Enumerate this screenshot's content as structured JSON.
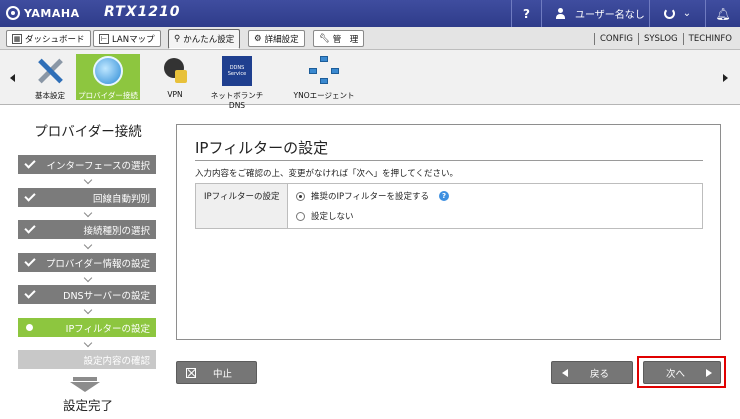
{
  "header": {
    "brand": "YAMAHA",
    "model": "RTX1210",
    "help_label": "?",
    "user_label": "ユーザー名なし"
  },
  "menu": {
    "items": [
      {
        "label": "ダッシュボード"
      },
      {
        "label": "LANマップ"
      },
      {
        "label": "かんたん設定"
      },
      {
        "label": "詳細設定"
      },
      {
        "label": "管　理"
      }
    ],
    "active": "かんたん設定",
    "right_links": [
      "CONFIG",
      "SYSLOG",
      "TECHINFO"
    ]
  },
  "features": [
    {
      "label": "基本設定",
      "icon": "tools-icon"
    },
    {
      "label": "プロバイダー接続",
      "icon": "globe-icon",
      "selected": true
    },
    {
      "label": "VPN",
      "icon": "vpn-lock-icon"
    },
    {
      "label": "ネットボランチDNS",
      "icon": "ddns-service-icon",
      "icon_text": "DDNS Service"
    },
    {
      "label": "YNOエージェント",
      "icon": "network-agent-icon"
    }
  ],
  "wizard": {
    "title": "プロバイダー接続",
    "steps": [
      {
        "label": "インターフェースの選択",
        "state": "done"
      },
      {
        "label": "回線自動判別",
        "state": "done"
      },
      {
        "label": "接続種別の選択",
        "state": "done"
      },
      {
        "label": "プロバイダー情報の設定",
        "state": "done"
      },
      {
        "label": "DNSサーバーの設定",
        "state": "done"
      },
      {
        "label": "IPフィルターの設定",
        "state": "current"
      },
      {
        "label": "設定内容の確認",
        "state": "pending"
      }
    ],
    "done_label": "設定完了"
  },
  "main": {
    "title": "IPフィルターの設定",
    "instruction": "入力内容をご確認の上、変更がなければ「次へ」を押してください。",
    "field_label": "IPフィルターの設定",
    "options": [
      {
        "label": "推奨のIPフィルターを設定する",
        "checked": true
      },
      {
        "label": "設定しない",
        "checked": false
      }
    ]
  },
  "buttons": {
    "cancel": "中止",
    "back": "戻る",
    "next": "次へ"
  },
  "colors": {
    "header_bg": "#3a4798",
    "accent_green": "#8dc63f",
    "button_gray": "#767676",
    "highlight_red": "#e00000"
  }
}
